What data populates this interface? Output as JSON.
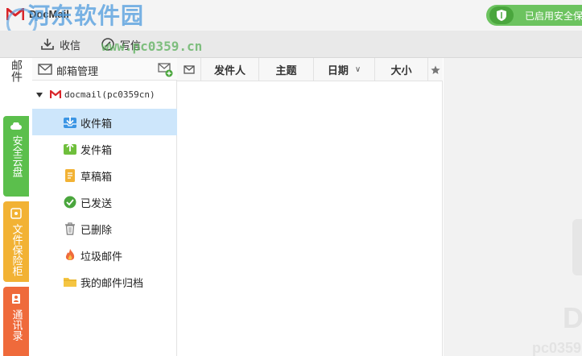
{
  "app": {
    "title": "DocMail"
  },
  "watermark": {
    "title": "河东软件园",
    "url": "www.pc0359.cn"
  },
  "security_badge": {
    "text": "已启用安全保护"
  },
  "toolbar": {
    "receive_label": "收信",
    "compose_label": "写信"
  },
  "side_tabs": {
    "mail": "邮件",
    "cloud": "安全云盘",
    "locker": "文件保险柜",
    "contacts": "通讯录"
  },
  "mailbox": {
    "header": "邮箱管理",
    "account": "docmail(pc0359cn)",
    "folders": [
      {
        "label": "收件箱",
        "icon": "inbox-icon",
        "selected": true
      },
      {
        "label": "发件箱",
        "icon": "outbox-icon",
        "selected": false
      },
      {
        "label": "草稿箱",
        "icon": "drafts-icon",
        "selected": false
      },
      {
        "label": "已发送",
        "icon": "sent-icon",
        "selected": false
      },
      {
        "label": "已删除",
        "icon": "trash-icon",
        "selected": false
      },
      {
        "label": "垃圾邮件",
        "icon": "spam-icon",
        "selected": false
      },
      {
        "label": "我的邮件归档",
        "icon": "archive-folder-icon",
        "selected": false
      }
    ]
  },
  "list_columns": {
    "sender": "发件人",
    "subject": "主题",
    "date": "日期",
    "size": "大小"
  },
  "preview": {
    "ghost_text": "D",
    "ghost_url": "pc0359"
  },
  "colors": {
    "brand_red": "#d9252a",
    "cloud_tab": "#5bbf4c",
    "locker_tab": "#f2b234",
    "contacts_tab": "#ef6a3b",
    "selected_row": "#cde6fb",
    "badge_green": "#6cc35f"
  }
}
